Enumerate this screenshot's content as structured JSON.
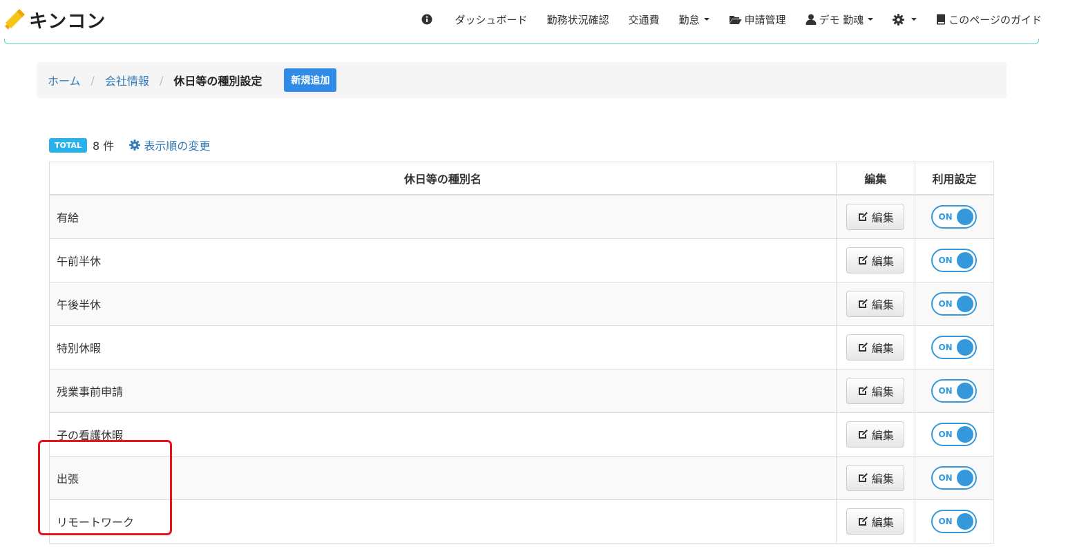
{
  "brand": {
    "name": "キンコン"
  },
  "nav": {
    "items": [
      {
        "key": "info",
        "label": "",
        "icon": "info-icon",
        "dropdown": false
      },
      {
        "key": "dashboard",
        "label": "ダッシュボード",
        "dropdown": false
      },
      {
        "key": "attendance-status",
        "label": "勤務状況確認",
        "dropdown": false
      },
      {
        "key": "transport",
        "label": "交通費",
        "dropdown": false
      },
      {
        "key": "kintai",
        "label": "勤怠",
        "dropdown": true
      },
      {
        "key": "applications",
        "label": "申請管理",
        "icon": "folder-open-icon",
        "dropdown": false
      },
      {
        "key": "user",
        "label": "デモ 勤魂",
        "icon": "user-icon",
        "dropdown": true
      },
      {
        "key": "settings",
        "label": "",
        "icon": "gear-icon",
        "dropdown": true
      },
      {
        "key": "guide",
        "label": "このページのガイド",
        "icon": "book-icon",
        "dropdown": false
      }
    ]
  },
  "breadcrumb": {
    "home": "ホーム",
    "company": "会社情報",
    "current": "休日等の種別設定",
    "new_button": "新規追加"
  },
  "summary": {
    "badge": "TOTAL",
    "count": "8 件",
    "reorder_label": "表示順の変更"
  },
  "table": {
    "headers": {
      "name": "休日等の種別名",
      "edit": "編集",
      "use": "利用設定"
    },
    "edit_label": "編集",
    "toggle_label": "ON",
    "rows": [
      {
        "name": "有給",
        "enabled": true
      },
      {
        "name": "午前半休",
        "enabled": true
      },
      {
        "name": "午後半休",
        "enabled": true
      },
      {
        "name": "特別休暇",
        "enabled": true
      },
      {
        "name": "残業事前申請",
        "enabled": true
      },
      {
        "name": "子の看護休暇",
        "enabled": true
      },
      {
        "name": "出張",
        "enabled": true
      },
      {
        "name": "リモートワーク",
        "enabled": true
      }
    ]
  },
  "colors": {
    "accent_blue": "#337ab7",
    "button_blue": "#2f8be5",
    "badge_blue": "#29b2ea",
    "toggle_blue": "#3498db",
    "highlight_red": "#e8151b",
    "brand_yellow": "#f5c518"
  }
}
